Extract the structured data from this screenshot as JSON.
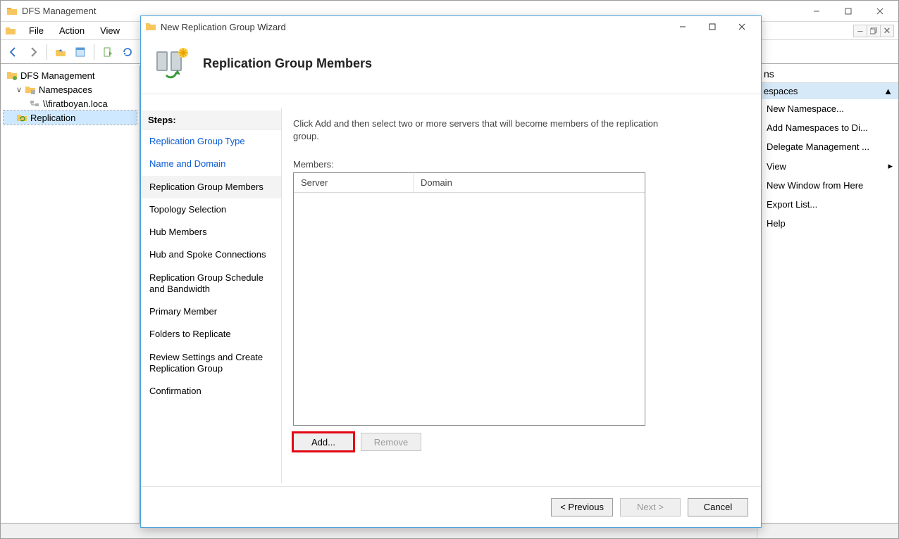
{
  "mmc": {
    "title": "DFS Management",
    "menubar": [
      "File",
      "Action",
      "View"
    ],
    "tree": {
      "root": "DFS Management",
      "namespaces": "Namespaces",
      "ns_path": "\\\\firatboyan.loca",
      "replication": "Replication"
    },
    "actions_pane": {
      "header": "ns",
      "context": "espaces",
      "items": [
        "New Namespace...",
        "Add Namespaces to Di...",
        "Delegate Management ...",
        "View",
        "New Window from Here",
        "Export List...",
        "Help"
      ]
    }
  },
  "wizard": {
    "title": "New Replication Group Wizard",
    "heading": "Replication Group Members",
    "steps_header": "Steps:",
    "steps": [
      "Replication Group Type",
      "Name and Domain",
      "Replication Group Members",
      "Topology Selection",
      "Hub Members",
      "Hub and Spoke Connections",
      "Replication Group Schedule and Bandwidth",
      "Primary Member",
      "Folders to Replicate",
      "Review Settings and Create Replication Group",
      "Confirmation"
    ],
    "instruction": "Click Add and then select two or more servers that will become members of the replication group.",
    "members_label": "Members:",
    "columns": {
      "server": "Server",
      "domain": "Domain"
    },
    "buttons": {
      "add": "Add...",
      "remove": "Remove",
      "previous": "< Previous",
      "next": "Next >",
      "cancel": "Cancel"
    }
  }
}
